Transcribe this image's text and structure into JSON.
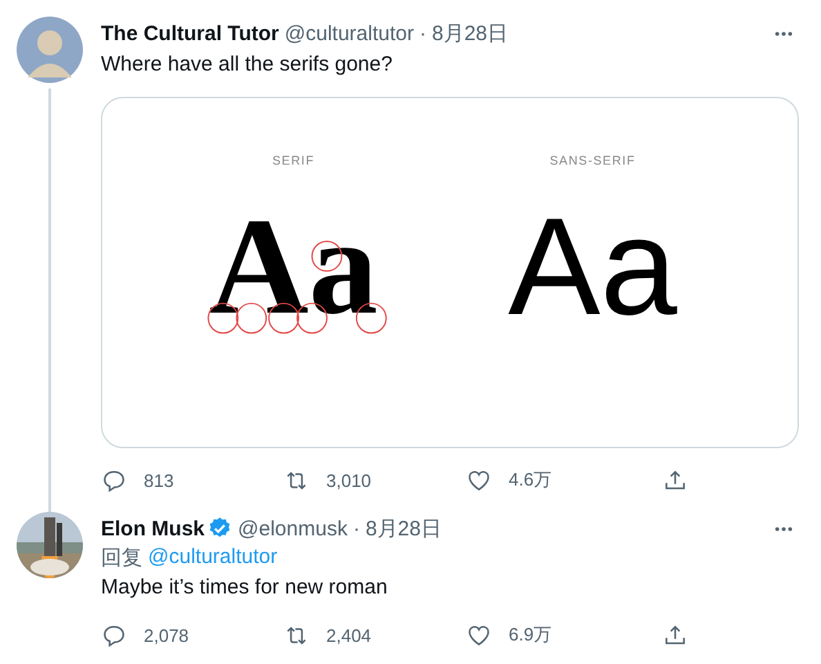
{
  "tweets": [
    {
      "avatar": {
        "kind": "silhouette"
      },
      "author": "The Cultural Tutor",
      "thread_line": true,
      "handle": "@culturaltutor",
      "separator": "·",
      "date": "8月28日",
      "text": "Where have all the serifs gone?",
      "media": {
        "panels": [
          {
            "kind": "serif",
            "label": "SERIF",
            "sample": "Aa"
          },
          {
            "kind": "sans",
            "label": "SANS-SERIF",
            "sample": "Aa"
          }
        ]
      },
      "stats": {
        "replies": "813",
        "retweets": "3,010",
        "likes": "4.6万"
      }
    },
    {
      "author": "Elon Musk",
      "verified": true,
      "handle": "@elonmusk",
      "separator": "·",
      "date": "8月28日",
      "reply_label": "回复",
      "reply_to": "@culturaltutor",
      "text": "Maybe it’s times for new roman",
      "stats": {
        "replies": "2,078",
        "retweets": "2,404",
        "likes": "6.9万"
      }
    }
  ]
}
